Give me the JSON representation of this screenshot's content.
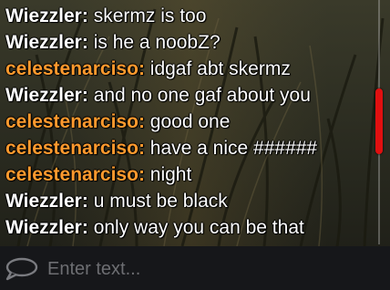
{
  "colors": {
    "user_wiezzler": "#ffffff",
    "user_celestenarciso": "#ff9a2e",
    "scrollbar_thumb": "#e01010",
    "placeholder": "#6d6e72"
  },
  "chat": {
    "messages": [
      {
        "author": "Wiezzler",
        "color": "#ffffff",
        "text": "skermz is too"
      },
      {
        "author": "Wiezzler",
        "color": "#ffffff",
        "text": "is he a noobZ?"
      },
      {
        "author": "celestenarciso",
        "color": "#ff9a2e",
        "text": "idgaf abt skermz"
      },
      {
        "author": "Wiezzler",
        "color": "#ffffff",
        "text": "and no one gaf about you"
      },
      {
        "author": "celestenarciso",
        "color": "#ff9a2e",
        "text": "good one"
      },
      {
        "author": "celestenarciso",
        "color": "#ff9a2e",
        "text": "have a nice ######"
      },
      {
        "author": "celestenarciso",
        "color": "#ff9a2e",
        "text": "night"
      },
      {
        "author": "Wiezzler",
        "color": "#ffffff",
        "text": "u must be black"
      },
      {
        "author": "Wiezzler",
        "color": "#ffffff",
        "text": "only way you can be that"
      }
    ]
  },
  "input": {
    "placeholder": "Enter text...",
    "value": "",
    "icon": "speech-bubble-icon"
  }
}
